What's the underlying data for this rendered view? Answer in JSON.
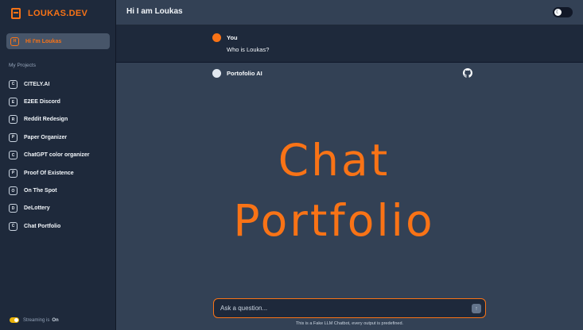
{
  "brand": {
    "name": "LOUKAS.DEV",
    "icon": "book-icon",
    "color": "#f97316"
  },
  "sidebar": {
    "active_chat": {
      "badge": "H",
      "label": "Hi I'm Loukas"
    },
    "section_title": "My Projects",
    "projects": [
      {
        "badge": "C",
        "label": "CITELY.AI"
      },
      {
        "badge": "E",
        "label": "E2EE Discord"
      },
      {
        "badge": "R",
        "label": "Reddit Redesign"
      },
      {
        "badge": "P",
        "label": "Paper Organizer"
      },
      {
        "badge": "C",
        "label": "ChatGPT color organizer"
      },
      {
        "badge": "P",
        "label": "Proof Of Existence"
      },
      {
        "badge": "O",
        "label": "On The Spot"
      },
      {
        "badge": "D",
        "label": "DeLottery"
      },
      {
        "badge": "C",
        "label": "Chat Portfolio"
      }
    ],
    "streaming": {
      "label": "Streaming is",
      "state": "On"
    }
  },
  "header": {
    "title": "Hi I am Loukas",
    "theme_icon": "moon-icon"
  },
  "conversation": {
    "user": {
      "name": "You",
      "text": "Who is Loukas?"
    },
    "assistant": {
      "name": "Portofolio AI",
      "link_icon": "github-icon"
    }
  },
  "hero": {
    "line1": "Chat",
    "line2": "Portfolio"
  },
  "composer": {
    "placeholder": "Ask a question...",
    "send_icon": "arrow-up-icon",
    "footnote": "This is a Fake LLM Chatbot, every output is predefined."
  },
  "colors": {
    "accent": "#f97316",
    "sidebar": "#1e293b",
    "main": "#334155"
  }
}
